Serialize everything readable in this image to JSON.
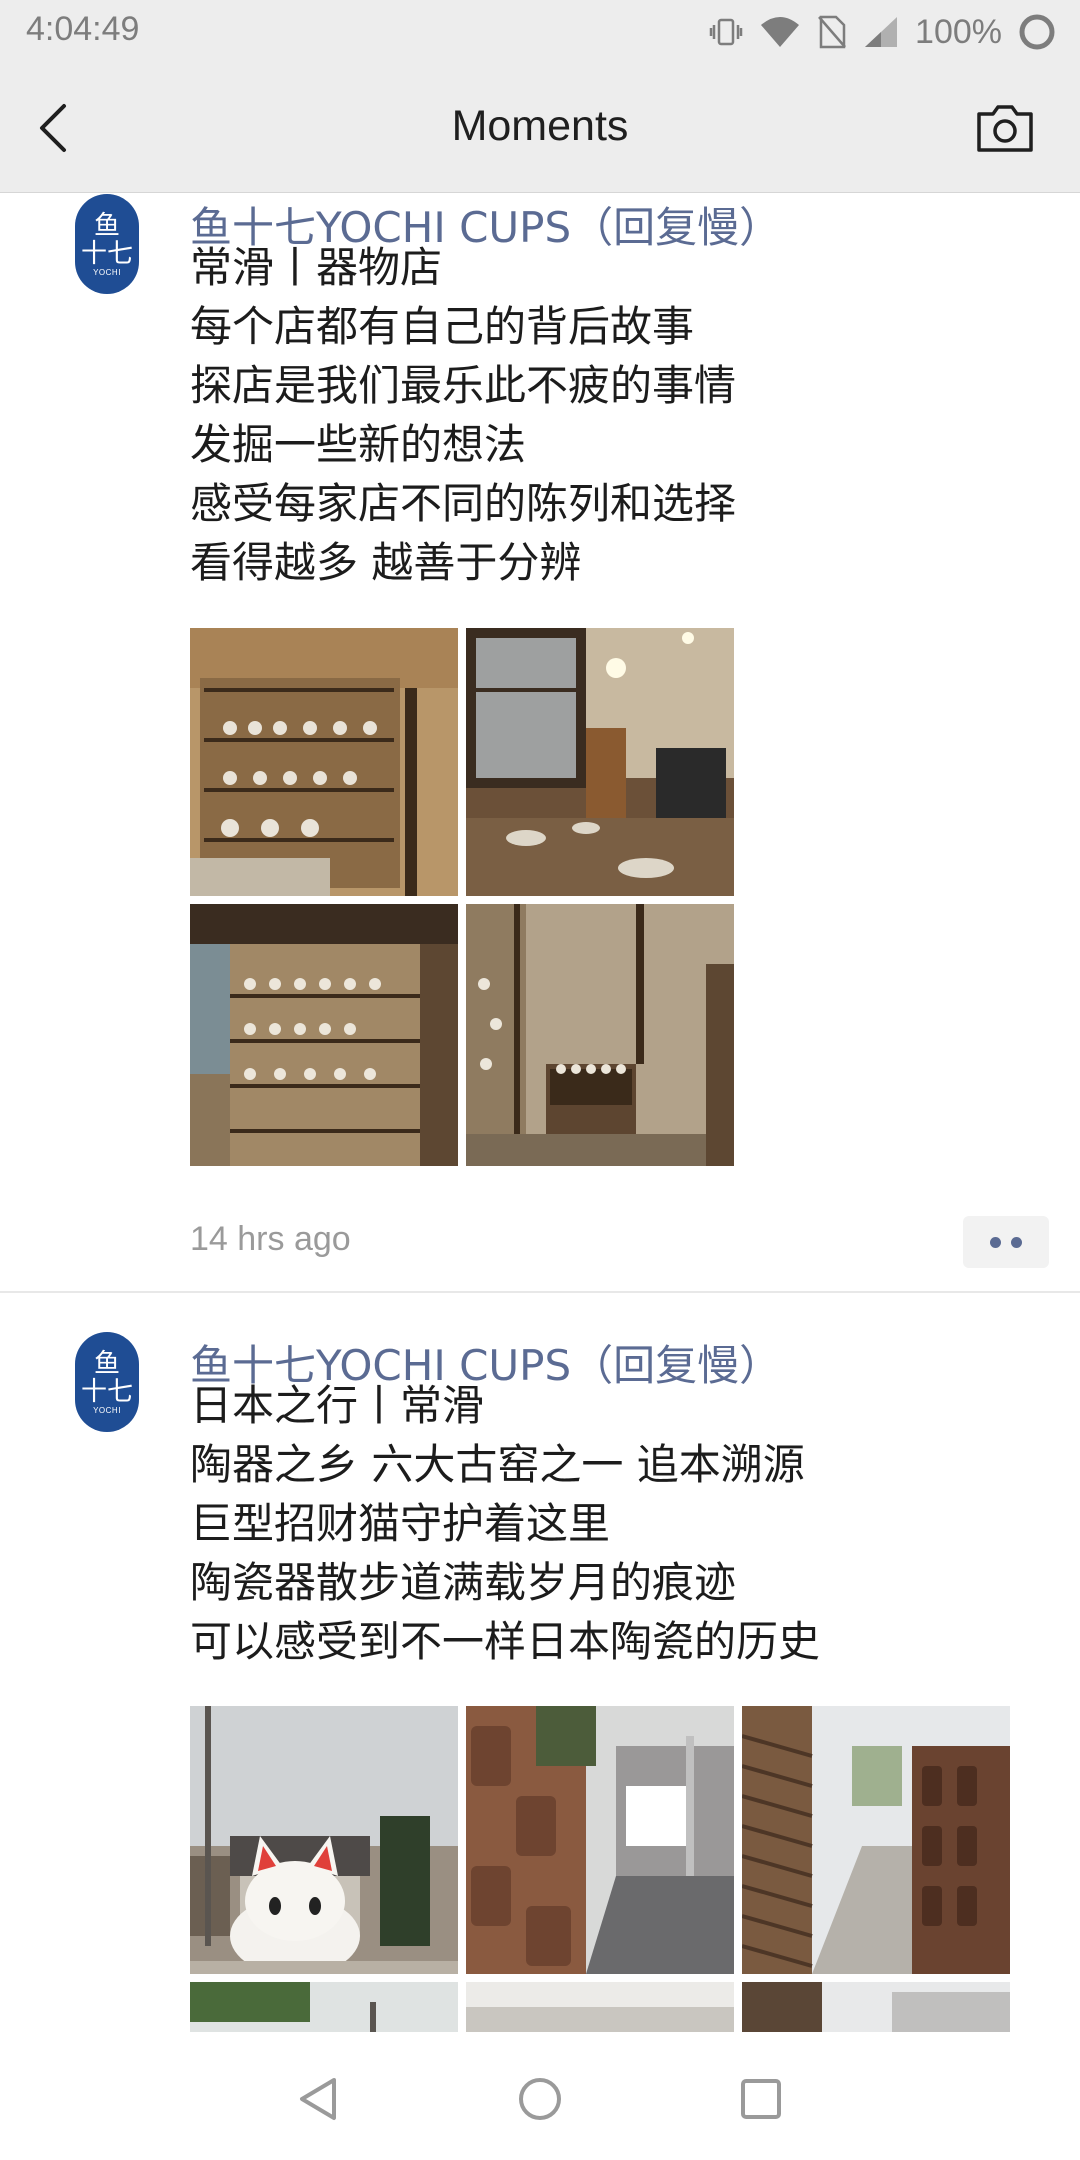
{
  "status_bar": {
    "time": "4:04:49",
    "battery": "100%"
  },
  "header": {
    "title": "Moments",
    "back_icon": "chevron-left-icon",
    "camera_icon": "camera-icon"
  },
  "posts": [
    {
      "author": "鱼十七YOCHI CUPS（回复慢）",
      "lines": [
        "常滑丨器物店",
        "每个店都有自己的背后故事",
        "探店是我们最乐此不疲的事情",
        "发掘一些新的想法",
        "感受每家店不同的陈列和选择",
        "看得越多 越善于分辨"
      ],
      "time": "14 hrs ago",
      "photos": [
        {
          "subject": "ceramics shop shelves"
        },
        {
          "subject": "shop interior with pendant lamps"
        },
        {
          "subject": "wooden shelving with cups"
        },
        {
          "subject": "display shelf against wall"
        }
      ]
    },
    {
      "author": "鱼十七YOCHI CUPS（回复慢）",
      "lines": [
        "日本之行丨常滑",
        "陶器之乡 六大古窑之一 追本溯源",
        "巨型招财猫守护着这里",
        "陶瓷器散步道满载岁月的痕迹",
        "可以感受到不一样日本陶瓷的历史"
      ],
      "photos": [
        {
          "subject": "giant maneki-neko cat"
        },
        {
          "subject": "clay pipe wall street"
        },
        {
          "subject": "pottery lined alley"
        },
        {
          "subject": "partial photo"
        },
        {
          "subject": "partial photo"
        },
        {
          "subject": "partial photo"
        }
      ]
    }
  ],
  "colors": {
    "link": "#5b6b93",
    "header_bg": "#ededed",
    "avatar": "#1f4d94"
  }
}
